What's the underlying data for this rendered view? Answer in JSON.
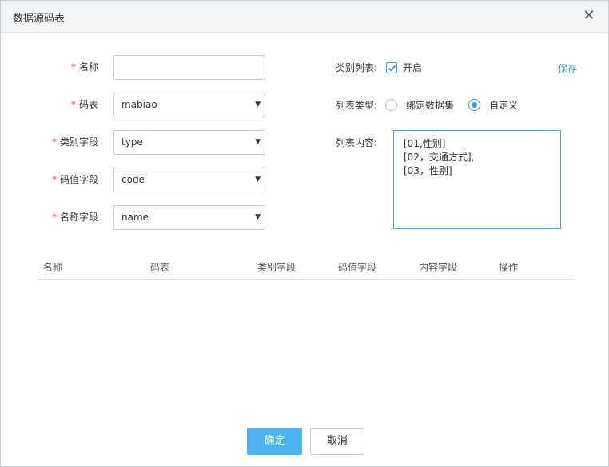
{
  "dialog": {
    "title": "数据源码表",
    "close_icon": "close-icon"
  },
  "form": {
    "name": {
      "label": "名称",
      "value": ""
    },
    "codetable": {
      "label": "码表",
      "value": "mabiao"
    },
    "category_field": {
      "label": "类别字段",
      "value": "type"
    },
    "code_field": {
      "label": "码值字段",
      "value": "code"
    },
    "name_field": {
      "label": "名称字段",
      "value": "name"
    },
    "required_mark": "*",
    "caret": "▼"
  },
  "options": {
    "category_list_label": "类别列表:",
    "enable_label": "开启",
    "enable_checked": true,
    "save_label": "保存",
    "list_type_label": "列表类型:",
    "bind_dataset_label": "绑定数据集",
    "custom_label": "自定义",
    "selected_type": "自定义",
    "list_content_label": "列表内容:",
    "list_content_lines": [
      "[01,性别]",
      "[02，交通方式],",
      "[03，性别]"
    ]
  },
  "table": {
    "headers": [
      "名称",
      "码表",
      "类别字段",
      "码值字段",
      "内容字段",
      "操作"
    ],
    "rows": []
  },
  "footer": {
    "confirm_label": "确定",
    "cancel_label": "取消"
  },
  "colors": {
    "accent": "#3b9be0",
    "primary_button": "#4ab3f0",
    "required": "#e64242"
  }
}
